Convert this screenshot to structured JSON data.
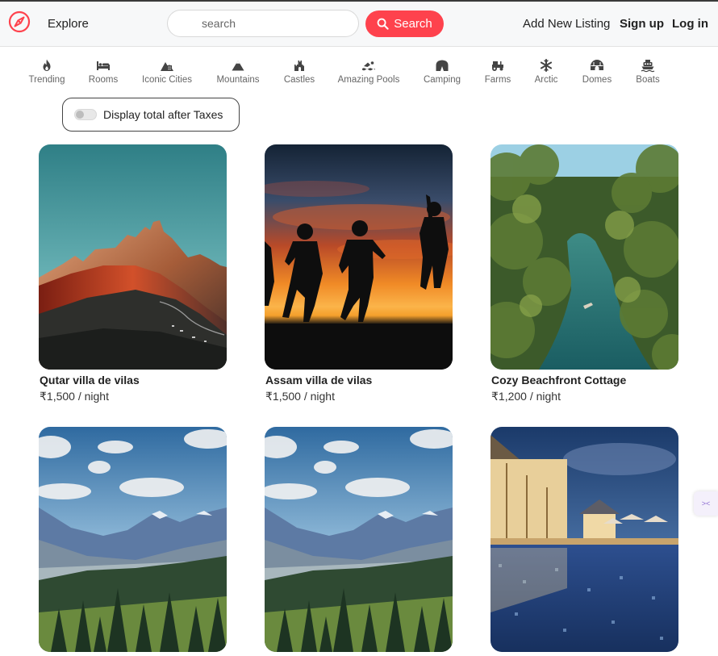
{
  "navbar": {
    "explore_label": "Explore",
    "search_placeholder": "search",
    "search_button_label": "Search",
    "add_listing_label": "Add New Listing",
    "signup_label": "Sign up",
    "login_label": "Log in"
  },
  "brand_color": "#fe424d",
  "filters": [
    {
      "label": "Trending",
      "icon": "fire-icon"
    },
    {
      "label": "Rooms",
      "icon": "bed-icon"
    },
    {
      "label": "Iconic Cities",
      "icon": "city-icon"
    },
    {
      "label": "Mountains",
      "icon": "mountain-icon"
    },
    {
      "label": "Castles",
      "icon": "castle-icon"
    },
    {
      "label": "Amazing Pools",
      "icon": "swimmer-icon"
    },
    {
      "label": "Camping",
      "icon": "tent-icon"
    },
    {
      "label": "Farms",
      "icon": "tractor-icon"
    },
    {
      "label": "Arctic",
      "icon": "snowflake-icon"
    },
    {
      "label": "Domes",
      "icon": "igloo-icon"
    },
    {
      "label": "Boats",
      "icon": "ferry-icon"
    }
  ],
  "tax_toggle": {
    "label": "Display total after Taxes",
    "enabled": false
  },
  "listings": [
    {
      "title": "Qutar villa de vilas",
      "price": "₹1,500 / night",
      "image": "mountain-sunset-photo"
    },
    {
      "title": "Assam villa de vilas",
      "price": "₹1,500 / night",
      "image": "sunset-silhouettes-photo"
    },
    {
      "title": "Cozy Beachfront Cottage",
      "price": "₹1,200 / night",
      "image": "palm-lagoon-photo"
    },
    {
      "title": "",
      "price": "",
      "image": "mountain-valley-photo"
    },
    {
      "title": "",
      "price": "",
      "image": "mountain-valley-photo"
    },
    {
      "title": "",
      "price": "",
      "image": "resort-pool-photo"
    }
  ]
}
